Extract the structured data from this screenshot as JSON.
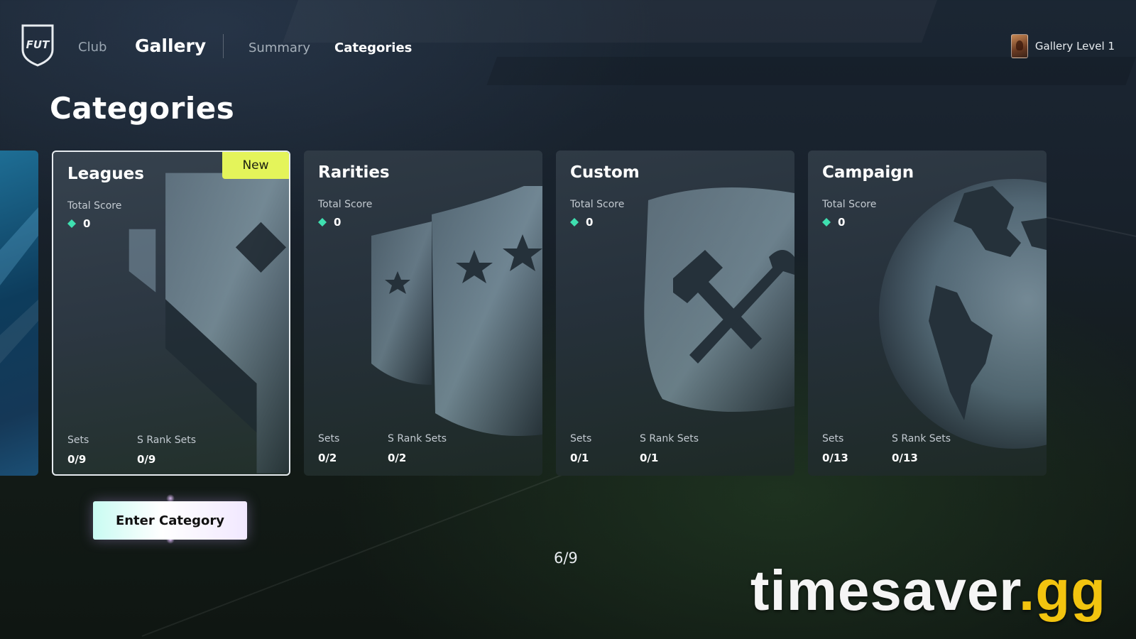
{
  "nav": {
    "club": "Club",
    "gallery": "Gallery",
    "summary": "Summary",
    "categories": "Categories",
    "gallery_level": "Gallery Level 1",
    "logo_text": "FUT"
  },
  "page_title": "Categories",
  "cards": [
    {
      "title": "Leagues",
      "badge": "New",
      "total_score_label": "Total Score",
      "total_score": "0",
      "sets_label": "Sets",
      "sets_value": "0/9",
      "srank_label": "S Rank Sets",
      "srank_value": "0/9",
      "icon": "league-trophy-icon",
      "selected": true
    },
    {
      "title": "Rarities",
      "total_score_label": "Total Score",
      "total_score": "0",
      "sets_label": "Sets",
      "sets_value": "0/2",
      "srank_label": "S Rank Sets",
      "srank_value": "0/2",
      "icon": "star-shield-icon"
    },
    {
      "title": "Custom",
      "total_score_label": "Total Score",
      "total_score": "0",
      "sets_label": "Sets",
      "sets_value": "0/1",
      "srank_label": "S Rank Sets",
      "srank_value": "0/1",
      "icon": "hammer-wrench-icon"
    },
    {
      "title": "Campaign",
      "total_score_label": "Total Score",
      "total_score": "0",
      "sets_label": "Sets",
      "sets_value": "0/13",
      "srank_label": "S Rank Sets",
      "srank_value": "0/13",
      "icon": "globe-icon"
    }
  ],
  "enter_button": "Enter Category",
  "pager": "6/9",
  "watermark": {
    "main": "timesaver",
    "tld": ".gg"
  },
  "colors": {
    "badge": "#e4f45a",
    "gem": "#3fe0b0",
    "watermark_tld": "#f2c40f"
  }
}
